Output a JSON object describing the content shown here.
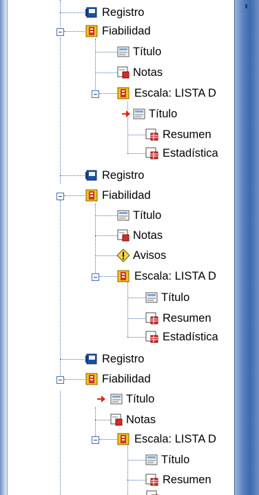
{
  "tree": {
    "nodes": [
      {
        "label": "Registro",
        "icon": "log-book-icon"
      },
      {
        "label": "Fiabilidad",
        "icon": "procedure-folder-icon",
        "expanded": true
      },
      {
        "label": "Título",
        "icon": "title-icon"
      },
      {
        "label": "Notas",
        "icon": "notes-icon"
      },
      {
        "label": "Escala: LISTA D",
        "icon": "procedure-folder-icon",
        "expanded": true
      },
      {
        "label": "Título",
        "icon": "title-icon",
        "selected_marker": true
      },
      {
        "label": "Resumen",
        "icon": "table-icon"
      },
      {
        "label": "Estadística",
        "icon": "table-icon"
      },
      {
        "label": "Registro",
        "icon": "log-book-icon"
      },
      {
        "label": "Fiabilidad",
        "icon": "procedure-folder-icon",
        "expanded": true
      },
      {
        "label": "Título",
        "icon": "title-icon"
      },
      {
        "label": "Notas",
        "icon": "notes-icon"
      },
      {
        "label": "Avisos",
        "icon": "warning-icon"
      },
      {
        "label": "Escala: LISTA D",
        "icon": "procedure-folder-icon",
        "expanded": true
      },
      {
        "label": "Título",
        "icon": "title-icon"
      },
      {
        "label": "Resumen",
        "icon": "table-icon"
      },
      {
        "label": "Estadística",
        "icon": "table-icon"
      },
      {
        "label": "Registro",
        "icon": "log-book-icon"
      },
      {
        "label": "Fiabilidad",
        "icon": "procedure-folder-icon",
        "expanded": true
      },
      {
        "label": "Título",
        "icon": "title-icon",
        "selected_marker": true
      },
      {
        "label": "Notas",
        "icon": "notes-icon"
      },
      {
        "label": "Escala: LISTA D",
        "icon": "procedure-folder-icon",
        "expanded": true
      },
      {
        "label": "Título",
        "icon": "title-icon"
      },
      {
        "label": "Resumen",
        "icon": "table-icon"
      }
    ]
  },
  "colors": {
    "tree_line": "#4a72b8",
    "selected_arrow": "#e8201c",
    "splitter": "#4a73b5"
  }
}
